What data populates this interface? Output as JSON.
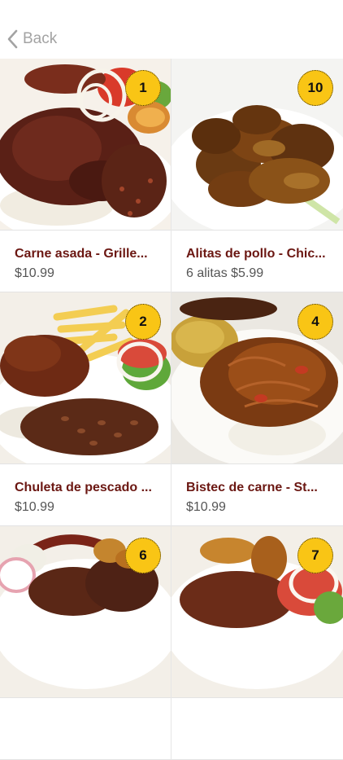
{
  "nav": {
    "back_label": "Back"
  },
  "items": [
    {
      "name": "Carne asada - Grille...",
      "price": "$10.99",
      "badge": "1"
    },
    {
      "name": "Alitas de pollo - Chic...",
      "price": "6 alitas $5.99",
      "badge": "10"
    },
    {
      "name": "Chuleta de pescado ...",
      "price": "$10.99",
      "badge": "2"
    },
    {
      "name": "Bistec de carne - St...",
      "price": "$10.99",
      "badge": "4"
    },
    {
      "name": "",
      "price": "",
      "badge": "6"
    },
    {
      "name": "",
      "price": "",
      "badge": "7"
    }
  ],
  "colors": {
    "badge": "#f9c515",
    "item_name": "#6b1712",
    "price": "#555555",
    "back": "#a3a3a3"
  },
  "icons": {
    "back": "chevron-left-icon"
  }
}
